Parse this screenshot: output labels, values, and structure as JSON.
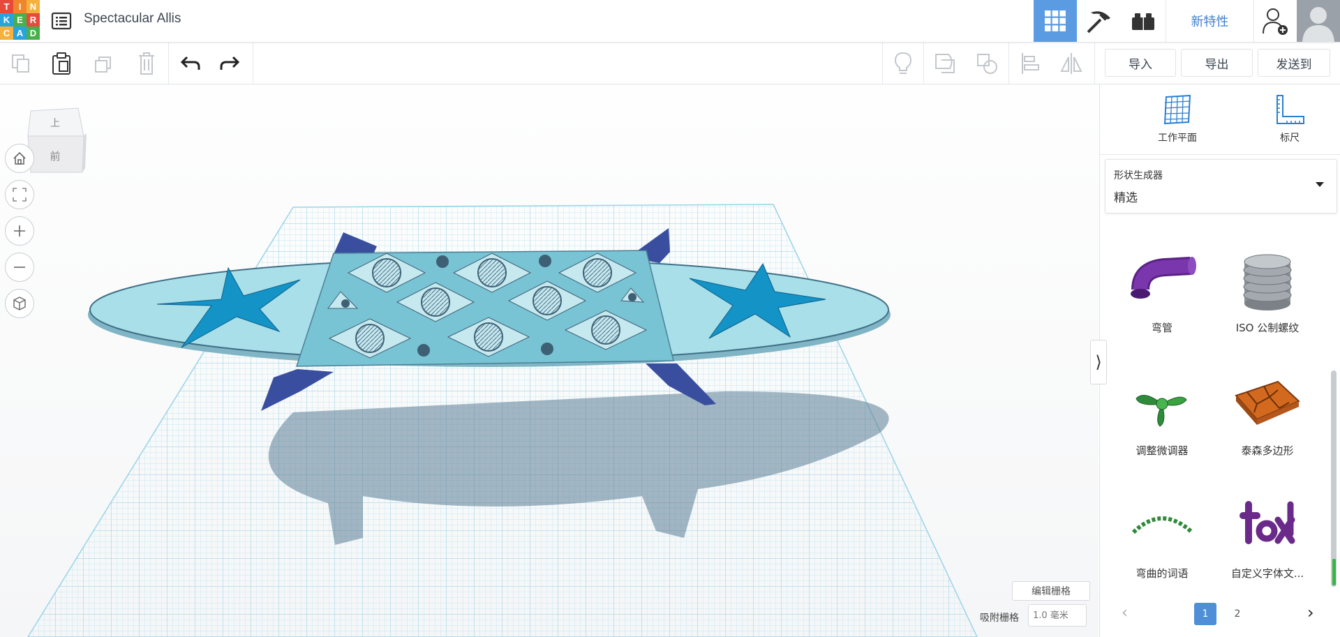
{
  "app": {
    "logo_letters": [
      "T",
      "I",
      "N",
      "K",
      "E",
      "R",
      "C",
      "A",
      "D"
    ],
    "logo_colors": [
      "#e74a3b",
      "#f0862b",
      "#f4b23c",
      "#29a3dd",
      "#48b04b",
      "#e74a3b",
      "#f4b23c",
      "#29a3dd",
      "#48b04b"
    ],
    "design_title": "Spectacular Allis"
  },
  "topnav": {
    "grid_icon": "3d-design-grid-icon",
    "pickaxe_icon": "minecraft-pickaxe-icon",
    "blocks_icon": "lego-bricks-icon",
    "whats_new_label": "新特性",
    "add_user_icon": "add-user-icon",
    "avatar_icon": "user-avatar"
  },
  "toolbar": {
    "import_label": "导入",
    "export_label": "导出",
    "send_to_label": "发送到"
  },
  "viewcube": {
    "top_label": "上",
    "front_label": "前"
  },
  "viewport": {
    "edit_grid_label": "编辑栅格",
    "snap_grid_label": "吸附栅格",
    "snap_grid_value": "1.0 毫米"
  },
  "panel": {
    "workplane_label": "工作平面",
    "ruler_label": "标尺",
    "shape_select_label": "形状生成器",
    "shape_select_value": "精选",
    "shapes": [
      {
        "label": "弯管",
        "color": "#6c2a9b"
      },
      {
        "label": "ISO 公制螺纹",
        "color": "#9aa0a6"
      },
      {
        "label": "调整微调器",
        "color": "#3aa23f"
      },
      {
        "label": "泰森多边形",
        "color": "#d2691e"
      },
      {
        "label": "弯曲的词语",
        "color": "#2f8a3a"
      },
      {
        "label": "自定义字体文...",
        "color": "#6a2a8a"
      }
    ],
    "pager": {
      "current": "1",
      "next_page": "2"
    }
  },
  "colors": {
    "accent_blue": "#5a9be2",
    "grid_blue": "#8fd3ea",
    "board": "#a7dee8",
    "center_panel": "#78c6d6",
    "star": "#1493c7",
    "legs": "#3b4f9c"
  }
}
